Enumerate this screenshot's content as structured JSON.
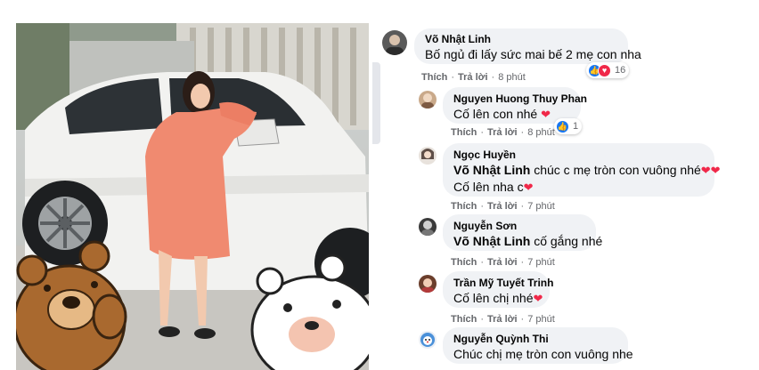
{
  "comments": [
    {
      "author": "Võ Nhật Linh",
      "mention": "",
      "text": "Bố ngủ đi lấy sức mai bế 2 mẹ con nha",
      "like_label": "Thích",
      "reply_label": "Trả lời",
      "time": "8 phút",
      "reaction_count": "16",
      "reactions": [
        "like-icon",
        "love-icon"
      ]
    },
    {
      "author": "Nguyen Huong Thuy Phan",
      "mention": "",
      "text": "Cố lên con nhé",
      "like_label": "Thích",
      "reply_label": "Trả lời",
      "time": "8 phút",
      "reaction_count": "1",
      "reactions": [
        "like-icon"
      ]
    },
    {
      "author": "Ngọc Huyền",
      "mention": "Võ Nhật Linh",
      "text": "chúc c mẹ tròn con vuông nhé",
      "text_line2": "Cố lên nha c",
      "like_label": "Thích",
      "reply_label": "Trả lời",
      "time": "7 phút"
    },
    {
      "author": "Nguyễn Sơn",
      "mention": "Võ Nhật Linh",
      "text": "cố gắng nhé",
      "like_label": "Thích",
      "reply_label": "Trả lời",
      "time": "7 phút"
    },
    {
      "author": "Trần Mỹ Tuyết Trinh",
      "mention": "",
      "text": "Cố lên chị nhé",
      "like_label": "Thích",
      "reply_label": "Trả lời",
      "time": "7 phút"
    },
    {
      "author": "Nguyễn Quỳnh Thi",
      "mention": "",
      "text": "Chúc chị mẹ tròn con vuông nhe"
    }
  ],
  "colors": {
    "bubble": "#f0f2f5",
    "meta": "#65676b",
    "like": "#1877f2",
    "love": "#f02849",
    "dress": "#f08a70"
  },
  "icons": [
    "heart-emoji",
    "like-icon",
    "love-icon",
    "bear-sticker",
    "car-photo"
  ]
}
